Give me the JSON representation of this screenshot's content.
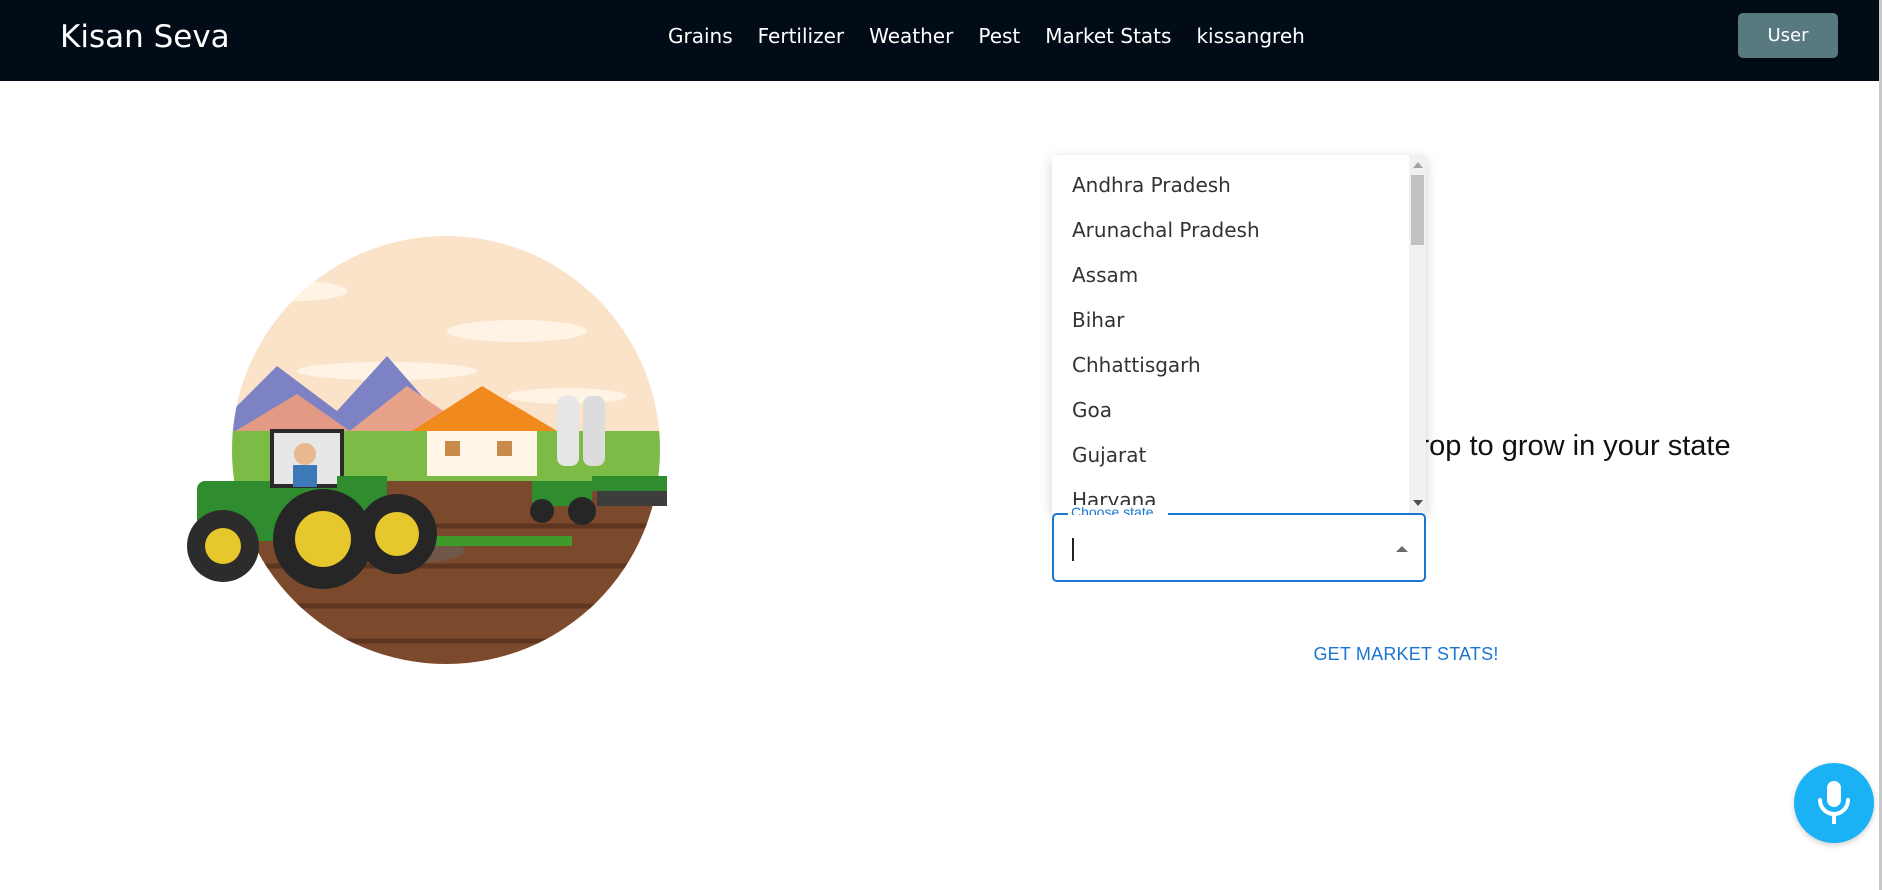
{
  "header": {
    "brand": "Kisan Seva",
    "nav": [
      {
        "label": "Grains"
      },
      {
        "label": "Fertilizer"
      },
      {
        "label": "Weather"
      },
      {
        "label": "Pest"
      },
      {
        "label": "Market Stats"
      },
      {
        "label": "kissangreh"
      }
    ],
    "user_label": "User"
  },
  "main": {
    "headline_visible": "crop to grow in your state",
    "state_select": {
      "label": "Choose state...",
      "value": "",
      "options": [
        "Andhra Pradesh",
        "Arunachal Pradesh",
        "Assam",
        "Bihar",
        "Chhattisgarh",
        "Goa",
        "Gujarat",
        "Haryana"
      ]
    },
    "action_label": "GET MARKET STATS!"
  },
  "colors": {
    "navbar_bg": "#020c17",
    "user_button": "#58797f",
    "accent": "#1976d2",
    "mic_button": "#1ab2f5"
  },
  "icons": {
    "mic": "microphone-icon",
    "dropdown_toggle": "caret-up-icon"
  }
}
